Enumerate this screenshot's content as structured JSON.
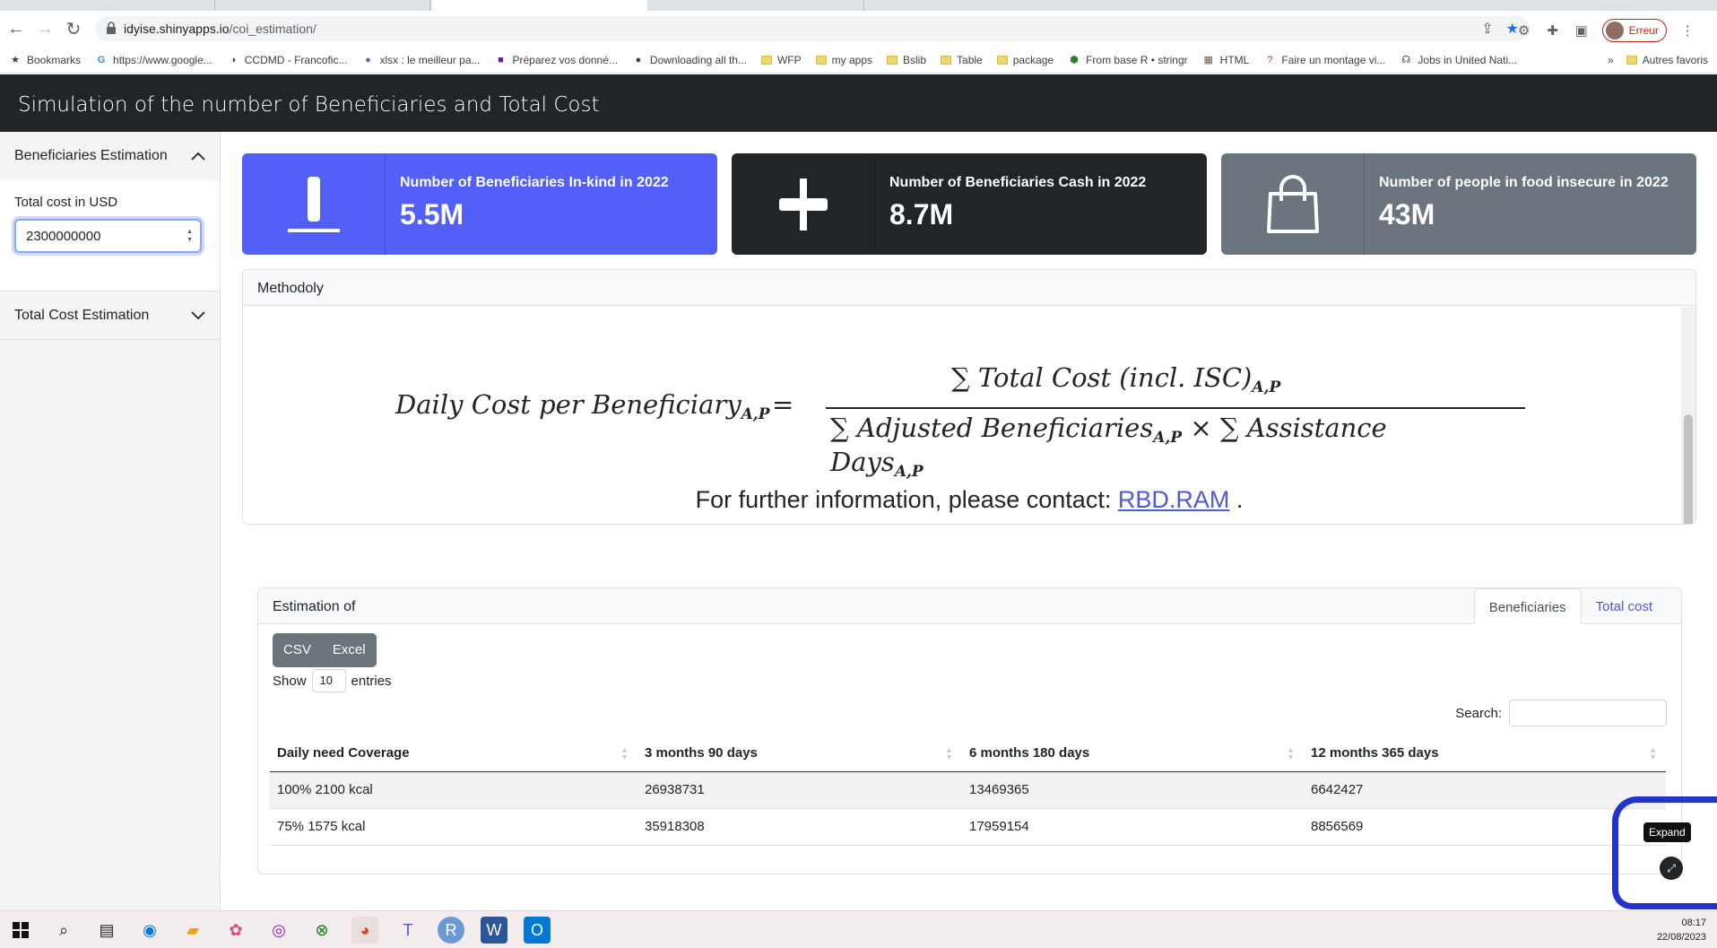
{
  "browser": {
    "url_host": "idyise.shinyapps.io",
    "url_path": "/coi_estimation/",
    "profile_label": "Erreur",
    "bookmarks": [
      {
        "label": "Bookmarks",
        "icon": "star-icon"
      },
      {
        "label": "https://www.google...",
        "icon": "google-icon"
      },
      {
        "label": "CCDMD - Francofic...",
        "icon": "site-icon"
      },
      {
        "label": "xlsx : le meilleur pa...",
        "icon": "site-icon"
      },
      {
        "label": "Préparez vos donné...",
        "icon": "site-icon"
      },
      {
        "label": "Downloading all th...",
        "icon": "github-icon"
      },
      {
        "label": "WFP",
        "icon": "folder-icon"
      },
      {
        "label": "my apps",
        "icon": "folder-icon"
      },
      {
        "label": "Bslib",
        "icon": "folder-icon"
      },
      {
        "label": "Table",
        "icon": "folder-icon"
      },
      {
        "label": "package",
        "icon": "folder-icon"
      },
      {
        "label": "From base R • stringr",
        "icon": "site-icon"
      },
      {
        "label": "HTML",
        "icon": "site-icon"
      },
      {
        "label": "Faire un montage vi...",
        "icon": "site-icon"
      },
      {
        "label": "Jobs in United Nati...",
        "icon": "site-icon"
      }
    ],
    "more_bookmarks": "»",
    "other_favorites": "Autres favoris"
  },
  "app": {
    "title": "Simulation of the number of Beneficiaries and Total Cost"
  },
  "sidebar": {
    "section1": "Beneficiaries Estimation",
    "input_label": "Total cost in USD",
    "input_value": "2300000000",
    "section2": "Total Cost Estimation"
  },
  "value_boxes": [
    {
      "title": "Number of Beneficiaries In-kind in 2022",
      "value": "5.5M",
      "color": "#5260f7"
    },
    {
      "title": "Number of Beneficiaries Cash in 2022",
      "value": "8.7M",
      "color": "#212529"
    },
    {
      "title": "Number of people in food insecure in 2022",
      "value": "43M",
      "color": "#6c757d"
    }
  ],
  "methodology": {
    "header": "Methodoly",
    "formula_lhs": "Daily Cost per Beneficiary",
    "formula_sub": "A,P",
    "formula_num": "∑ Total Cost (incl. ISC)",
    "formula_den_1": "∑ Adjusted Beneficiaries",
    "formula_den_times": " × ∑ Assistance Days",
    "contact_text": "For further information, please contact: ",
    "contact_link": "RBD.RAM",
    "contact_end": " ."
  },
  "estimation": {
    "header": "Estimation of",
    "tabs": [
      "Beneficiaries",
      "Total cost"
    ],
    "buttons": [
      "CSV",
      "Excel"
    ],
    "show_label": "Show",
    "show_value": "10",
    "entries_label": "entries",
    "search_label": "Search:",
    "columns": [
      "Daily need Coverage",
      "3 months 90 days",
      "6 months 180 days",
      "12 months 365 days"
    ],
    "rows": [
      [
        "100% 2100 kcal",
        "26938731",
        "13469365",
        "6642427"
      ],
      [
        "75% 1575 kcal",
        "35918308",
        "17959154",
        "8856569"
      ]
    ]
  },
  "tooltip": "Expand",
  "taskbar": {
    "time": "08:17",
    "date": "22/08/2023"
  }
}
